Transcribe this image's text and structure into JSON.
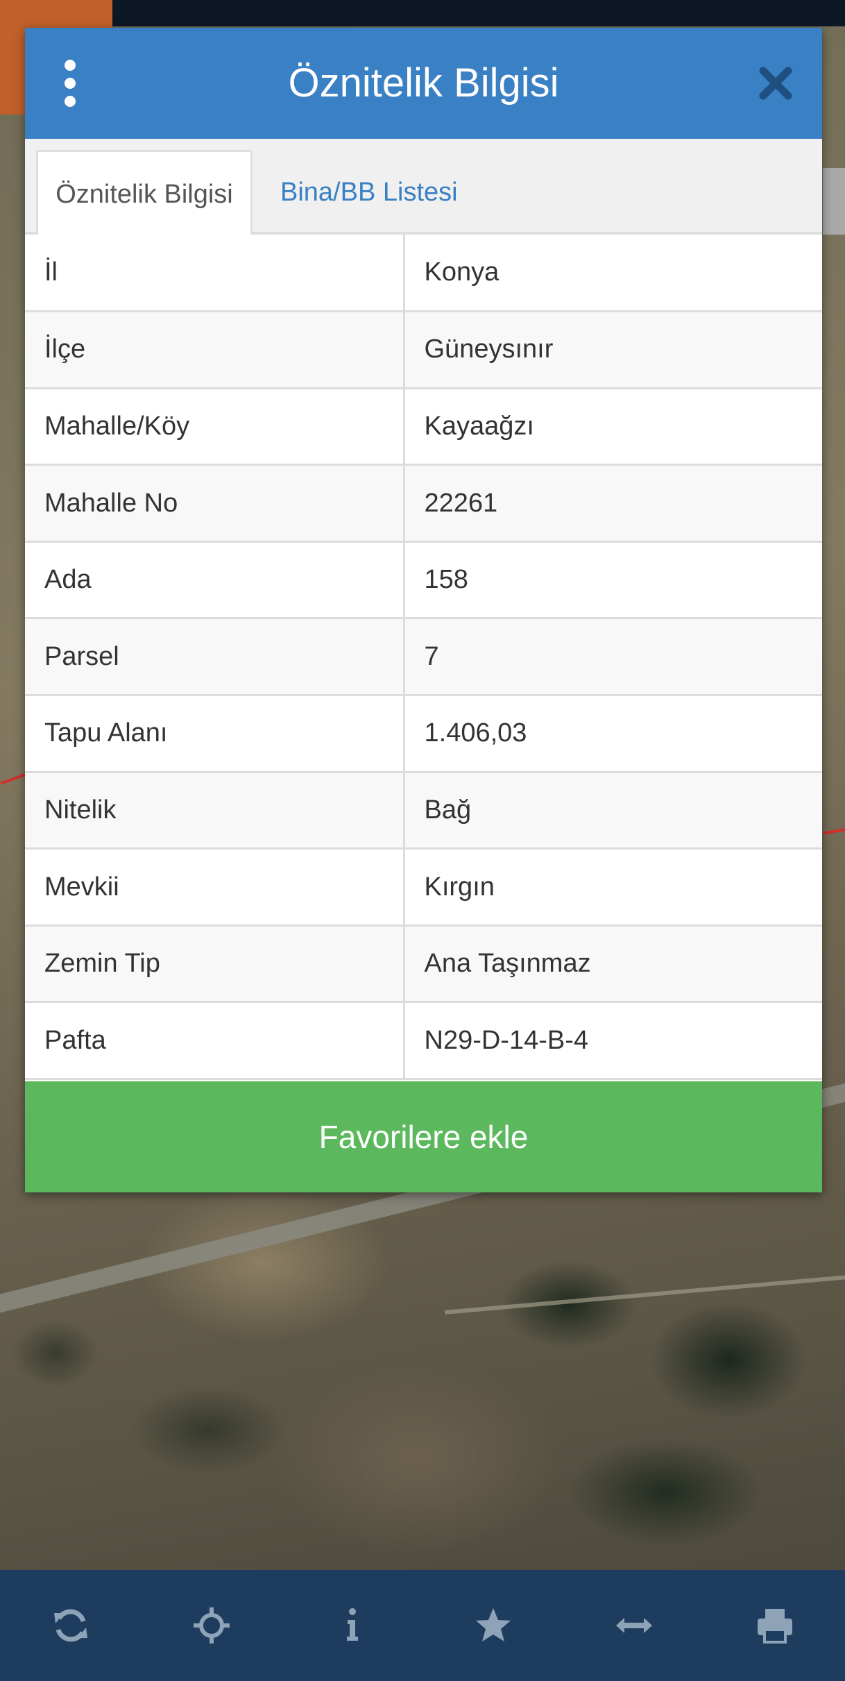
{
  "dialog": {
    "title": "Öznitelik Bilgisi",
    "tabs": [
      {
        "label": "Öznitelik Bilgisi",
        "active": true
      },
      {
        "label": "Bina/BB Listesi",
        "active": false
      }
    ],
    "rows": [
      {
        "key": "İl",
        "value": "Konya"
      },
      {
        "key": "İlçe",
        "value": "Güneysınır"
      },
      {
        "key": "Mahalle/Köy",
        "value": "Kayaağzı"
      },
      {
        "key": "Mahalle No",
        "value": "22261"
      },
      {
        "key": "Ada",
        "value": "158"
      },
      {
        "key": "Parsel",
        "value": "7"
      },
      {
        "key": "Tapu Alanı",
        "value": "1.406,03"
      },
      {
        "key": "Nitelik",
        "value": "Bağ"
      },
      {
        "key": "Mevkii",
        "value": "Kırgın"
      },
      {
        "key": "Zemin Tip",
        "value": "Ana Taşınmaz"
      },
      {
        "key": "Pafta",
        "value": "N29-D-14-B-4"
      }
    ],
    "favorite_label": "Favorilere ekle"
  },
  "toolbar": {
    "icons": [
      "refresh-icon",
      "crosshair-icon",
      "info-icon",
      "star-icon",
      "measure-arrows-icon",
      "print-icon"
    ]
  },
  "colors": {
    "header": "#3a80c4",
    "favorite": "#5cb85c",
    "toolbar": "#1e3d5e",
    "toolbar_icon": "#8fa3b8",
    "tab_link": "#3a80c4"
  }
}
